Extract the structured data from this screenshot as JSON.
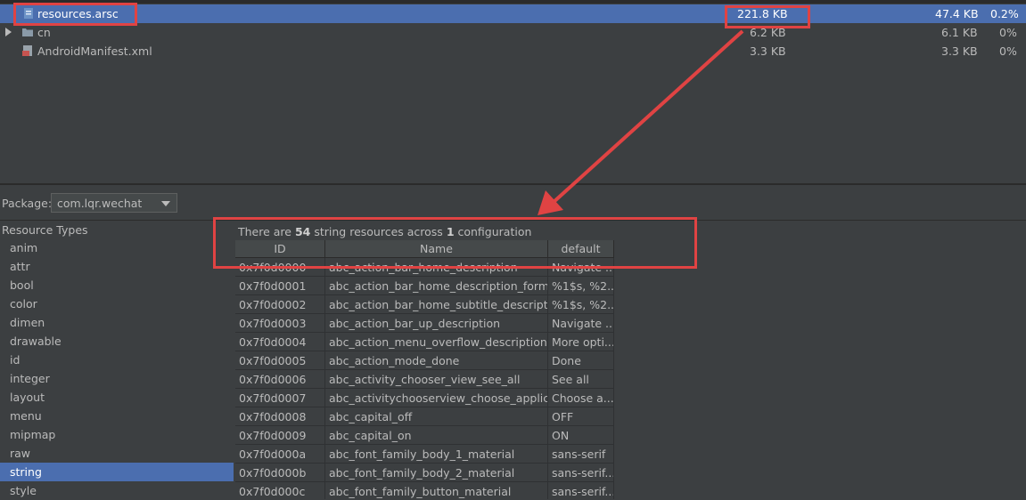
{
  "files": [
    {
      "name": "resources.arsc",
      "raw_size": "221.8 KB",
      "download_size": "47.4 KB",
      "percent": "0.2%",
      "icon": "arsc-file-icon",
      "selected": true
    },
    {
      "name": "cn",
      "raw_size": "6.2 KB",
      "download_size": "6.1 KB",
      "percent": "0%",
      "icon": "folder-icon",
      "selected": false
    },
    {
      "name": "AndroidManifest.xml",
      "raw_size": "3.3 KB",
      "download_size": "3.3 KB",
      "percent": "0%",
      "icon": "xml-file-icon",
      "selected": false
    }
  ],
  "package": {
    "label": "Package:",
    "value": "com.lqr.wechat"
  },
  "resource_types": {
    "header": "Resource Types",
    "items": [
      "anim",
      "attr",
      "bool",
      "color",
      "dimen",
      "drawable",
      "id",
      "integer",
      "layout",
      "menu",
      "mipmap",
      "raw",
      "string",
      "style"
    ],
    "selected": "string"
  },
  "summary": {
    "prefix": "There are ",
    "count": "54",
    "middle": " string resources across ",
    "configs": "1",
    "suffix": " configuration"
  },
  "table": {
    "columns": [
      "ID",
      "Name",
      "default"
    ],
    "rows": [
      [
        "0x7f0d0000",
        "abc_action_bar_home_description",
        "Navigate ..."
      ],
      [
        "0x7f0d0001",
        "abc_action_bar_home_description_format",
        "%1$s, %2..."
      ],
      [
        "0x7f0d0002",
        "abc_action_bar_home_subtitle_descriptio...",
        "%1$s, %2..."
      ],
      [
        "0x7f0d0003",
        "abc_action_bar_up_description",
        "Navigate ..."
      ],
      [
        "0x7f0d0004",
        "abc_action_menu_overflow_description",
        "More opti..."
      ],
      [
        "0x7f0d0005",
        "abc_action_mode_done",
        "Done"
      ],
      [
        "0x7f0d0006",
        "abc_activity_chooser_view_see_all",
        "See all"
      ],
      [
        "0x7f0d0007",
        "abc_activitychooserview_choose_applica...",
        "Choose a..."
      ],
      [
        "0x7f0d0008",
        "abc_capital_off",
        "OFF"
      ],
      [
        "0x7f0d0009",
        "abc_capital_on",
        "ON"
      ],
      [
        "0x7f0d000a",
        "abc_font_family_body_1_material",
        "sans-serif"
      ],
      [
        "0x7f0d000b",
        "abc_font_family_body_2_material",
        "sans-serif..."
      ],
      [
        "0x7f0d000c",
        "abc_font_family_button_material",
        "sans-serif..."
      ]
    ]
  },
  "colors": {
    "selection": "#4b6eaf",
    "annotation": "#e04343",
    "background": "#3c3f41"
  }
}
